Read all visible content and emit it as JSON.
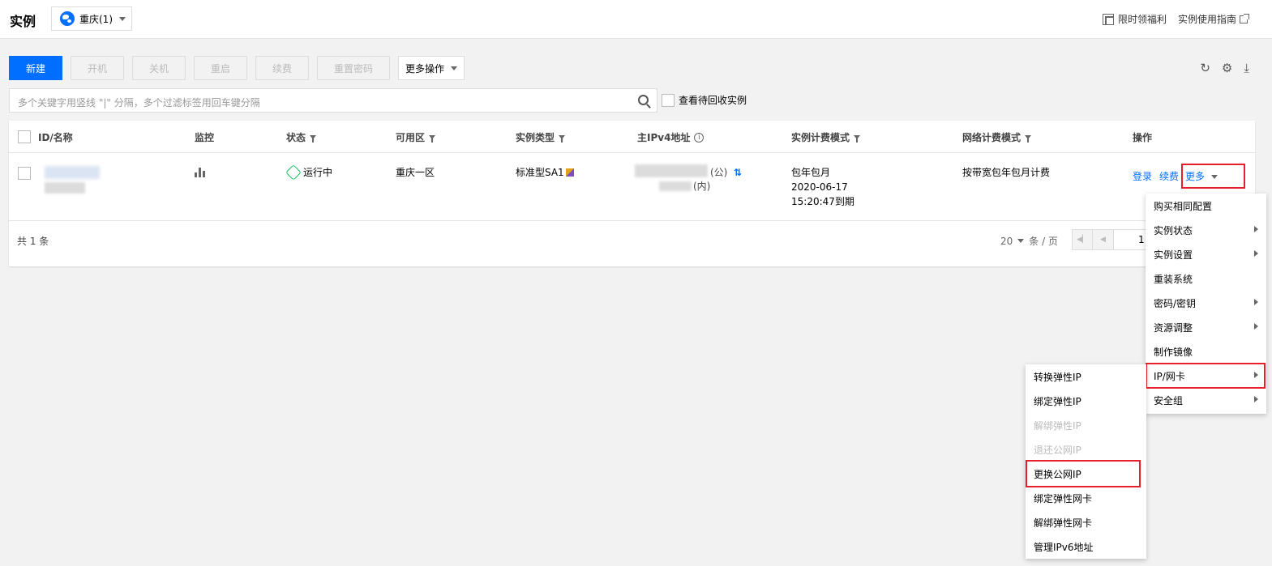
{
  "header": {
    "title": "实例",
    "region": "重庆(1)",
    "promo_link": "限时领福利",
    "guide_link": "实例使用指南"
  },
  "toolbar": {
    "new": "新建",
    "start": "开机",
    "stop": "关机",
    "restart": "重启",
    "renew": "续费",
    "reset_password": "重置密码",
    "more_actions": "更多操作",
    "icons": [
      "refresh-icon",
      "settings-icon",
      "download-icon"
    ]
  },
  "search": {
    "placeholder": "多个关键字用竖线 \"|\" 分隔，多个过滤标签用回车键分隔",
    "recycle_label": "查看待回收实例"
  },
  "table": {
    "columns": {
      "id_name": "ID/名称",
      "monitor": "监控",
      "status": "状态",
      "zone": "可用区",
      "instance_type": "实例类型",
      "ipv4": "主IPv4地址",
      "billing_mode": "实例计费模式",
      "network_billing": "网络计费模式",
      "actions": "操作"
    },
    "row": {
      "status": "运行中",
      "zone": "重庆一区",
      "instance_type": "标准型SA1",
      "ip_public_suffix": "(公)",
      "ip_private_suffix": "(内)",
      "billing_line1": "包年包月",
      "billing_line2": "2020-06-17",
      "billing_line3": "15:20:47到期",
      "network_billing": "按带宽包年包月计费",
      "action_login": "登录",
      "action_renew": "续费",
      "action_more": "更多"
    },
    "footer": {
      "total": "共 1 条",
      "page_size": "20",
      "page_size_unit": "条 / 页",
      "page_number": "1"
    }
  },
  "more_menu": {
    "items": [
      {
        "label": "购买相同配置",
        "submenu": false
      },
      {
        "label": "实例状态",
        "submenu": true
      },
      {
        "label": "实例设置",
        "submenu": true
      },
      {
        "label": "重装系统",
        "submenu": false
      },
      {
        "label": "密码/密钥",
        "submenu": true
      },
      {
        "label": "资源调整",
        "submenu": true
      },
      {
        "label": "制作镜像",
        "submenu": false
      },
      {
        "label": "IP/网卡",
        "submenu": true
      },
      {
        "label": "安全组",
        "submenu": true
      }
    ]
  },
  "ip_submenu": {
    "items": [
      {
        "label": "转换弹性IP",
        "disabled": false
      },
      {
        "label": "绑定弹性IP",
        "disabled": false
      },
      {
        "label": "解绑弹性IP",
        "disabled": true
      },
      {
        "label": "退还公网IP",
        "disabled": true
      },
      {
        "label": "更换公网IP",
        "disabled": false
      },
      {
        "label": "绑定弹性网卡",
        "disabled": false
      },
      {
        "label": "解绑弹性网卡",
        "disabled": false
      },
      {
        "label": "管理IPv6地址",
        "disabled": false
      }
    ]
  },
  "colors": {
    "primary": "#006eff",
    "running": "#0abf5b",
    "highlight": "#e5202a"
  }
}
